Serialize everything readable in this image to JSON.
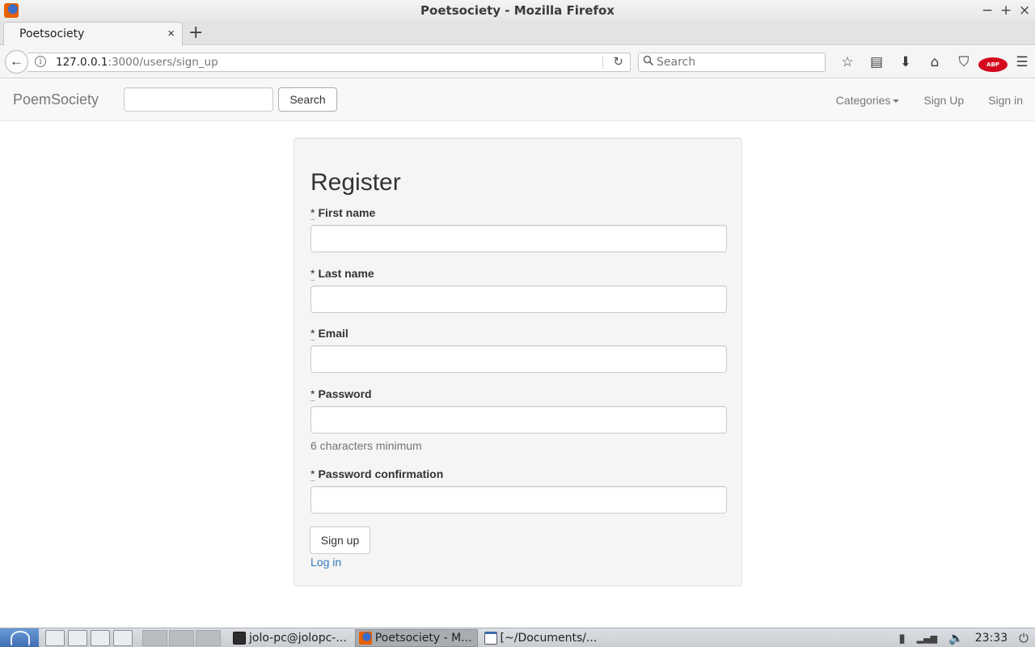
{
  "window": {
    "title": "Poetsociety - Mozilla Firefox",
    "minimize_glyph": "−",
    "maximize_glyph": "+",
    "close_glyph": "×"
  },
  "browser": {
    "tab_title": "Poetsociety",
    "tab_close_glyph": "×",
    "new_tab_glyph": "+",
    "back_glyph": "←",
    "info_glyph": "i",
    "url_host": "127.0.0.1",
    "url_rest": ":3000/users/sign_up",
    "reload_glyph": "↻",
    "search_placeholder": "Search",
    "toolbar_icons": {
      "bookmark": "☆",
      "reading_list": "▤",
      "download": "⬇",
      "home": "⌂",
      "pocket": "⛉",
      "adblock": "ABP",
      "menu": "☰"
    }
  },
  "site": {
    "brand": "PoemSociety",
    "search_input_value": "",
    "search_button": "Search",
    "nav": {
      "categories": "Categories",
      "sign_up": "Sign Up",
      "sign_in": "Sign in"
    }
  },
  "form": {
    "title": "Register",
    "required_mark": "*",
    "fields": [
      {
        "label": "First name",
        "value": ""
      },
      {
        "label": "Last name",
        "value": ""
      },
      {
        "label": "Email",
        "value": ""
      },
      {
        "label": "Password",
        "value": ""
      },
      {
        "label": "Password confirmation",
        "value": ""
      }
    ],
    "password_hint": "6 characters minimum",
    "submit": "Sign up",
    "login_link": "Log in"
  },
  "taskbar": {
    "tasks": [
      {
        "label": "jolo-pc@jolopc-...",
        "active": false
      },
      {
        "label": "Poetsociety - M...",
        "active": true
      },
      {
        "label": "[~/Documents/...",
        "active": false
      }
    ],
    "clock": "23:33",
    "tray_icons": {
      "battery": "▮",
      "network": "▂▄▆",
      "volume": "🔈",
      "power": "⏻"
    }
  }
}
